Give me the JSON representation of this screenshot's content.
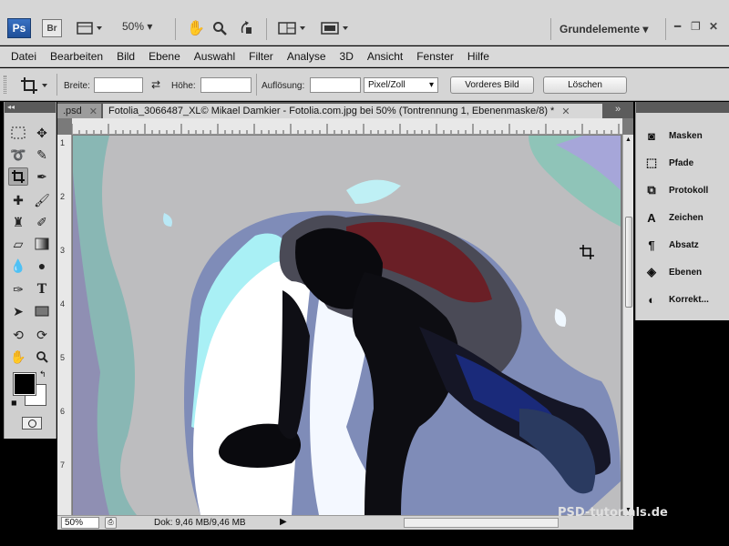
{
  "appbar": {
    "ps_label": "Ps",
    "br_label": "Br",
    "zoom_level": "50%",
    "workspace": "Grundelemente"
  },
  "menu": [
    "Datei",
    "Bearbeiten",
    "Bild",
    "Ebene",
    "Auswahl",
    "Filter",
    "Analyse",
    "3D",
    "Ansicht",
    "Fenster",
    "Hilfe"
  ],
  "options": {
    "width_label": "Breite:",
    "height_label": "Höhe:",
    "resolution_label": "Auflösung:",
    "resolution_unit": "Pixel/Zoll",
    "front_image_button": "Vorderes Bild",
    "clear_button": "Löschen"
  },
  "tabs": {
    "inactive_label": ".psd",
    "active_label": "Fotolia_3066487_XL© Mikael Damkier - Fotolia.com.jpg bei 50% (Tontrennung 1, Ebenenmaske/8) *"
  },
  "ruler_left": [
    "1",
    "2",
    "3",
    "4",
    "5",
    "6",
    "7"
  ],
  "status": {
    "zoom": "50%",
    "doc_info": "Dok: 9,46 MB/9,46 MB"
  },
  "panels": [
    {
      "label": "Masken",
      "icon": "mask-icon"
    },
    {
      "label": "Pfade",
      "icon": "paths-icon"
    },
    {
      "label": "Protokoll",
      "icon": "history-icon"
    },
    {
      "label": "Zeichen",
      "icon": "character-icon"
    },
    {
      "label": "Absatz",
      "icon": "paragraph-icon"
    },
    {
      "label": "Ebenen",
      "icon": "layers-icon"
    },
    {
      "label": "Korrekt...",
      "icon": "adjustments-icon"
    }
  ],
  "watermark": "PSD-tutorials.de",
  "colors": {
    "foreground": "#000000",
    "background": "#ffffff"
  }
}
